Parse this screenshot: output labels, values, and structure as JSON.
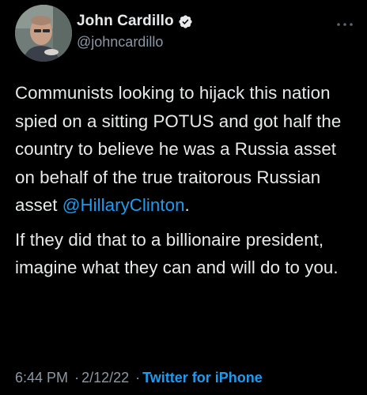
{
  "user": {
    "display_name": "John Cardillo",
    "handle": "@johncardillo"
  },
  "tweet": {
    "paragraph1": "Communists looking to hijack this nation spied on a sitting POTUS and got half the country to believe he was a Russia asset on behalf of the true traitorous Russian asset ",
    "mention": "@HillaryClinton",
    "mention_suffix": ".",
    "paragraph2": "If they did that to a billionaire president, imagine what they can and will do to you."
  },
  "meta": {
    "time": "6:44 PM",
    "separator": "·",
    "date": "2/12/22",
    "separator2": "·",
    "source": "Twitter for iPhone"
  },
  "colors": {
    "background": "#000000",
    "text": "#e7e9ea",
    "secondary": "#8b98a5",
    "accent": "#1d9bf0"
  },
  "icons": {
    "verified": "verified-badge-icon",
    "more": "more-options-icon"
  }
}
